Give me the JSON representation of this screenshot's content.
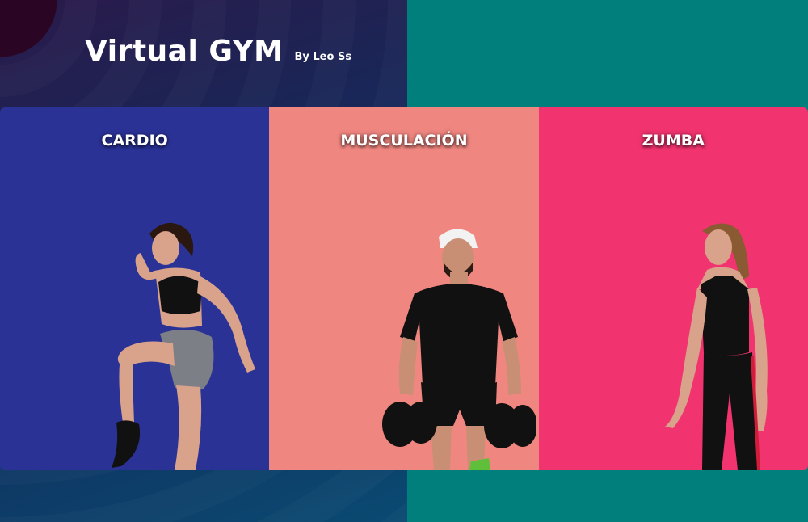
{
  "app": {
    "title": "Virtual GYM",
    "byline": "By Leo Ss"
  },
  "panels": [
    {
      "label": "CARDIO",
      "color": "#2a3296",
      "image": "woman-running-high-knee"
    },
    {
      "label": "MUSCULACIÓN",
      "color": "#f08680",
      "image": "man-holding-dumbbells"
    },
    {
      "label": "ZUMBA",
      "color": "#f1346f",
      "image": "woman-standing"
    }
  ],
  "colors": {
    "left_background": "#182758",
    "right_background": "#017f7d"
  }
}
